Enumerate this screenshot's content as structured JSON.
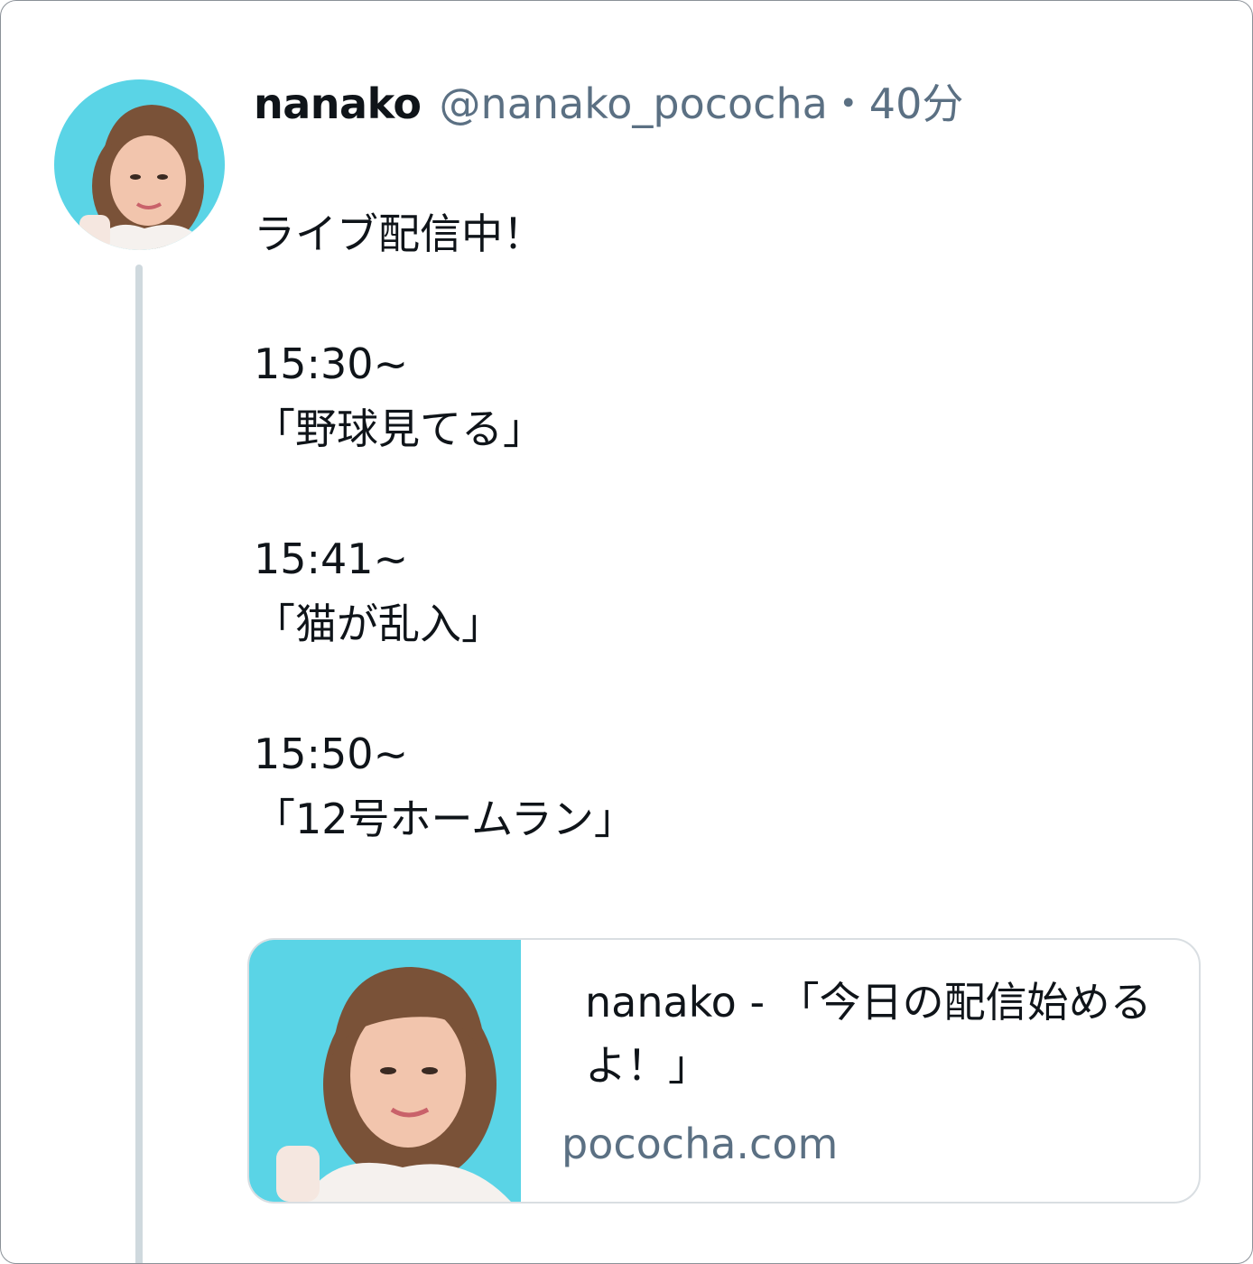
{
  "post": {
    "display_name": "nanako",
    "handle": "@nanako_pococha",
    "separator": "・",
    "time": "40分",
    "avatar": "avatar-photo",
    "body_lines": [
      "ライブ配信中！",
      "",
      "15:30~",
      "「野球見てる」",
      "",
      "15:41~",
      "「猫が乱入」",
      "",
      "15:50~",
      "「12号ホームラン」"
    ]
  },
  "link_card": {
    "title": "nanako - 「今日の配信始めるよ！」",
    "domain": "pococha.com",
    "thumbnail": "link-thumbnail-photo"
  },
  "colors": {
    "text": "#0f1419",
    "secondary": "#5b7083",
    "thread_line": "#cfd9de",
    "card_border": "#d9dee2",
    "photo_background": "#5ad4e6"
  }
}
